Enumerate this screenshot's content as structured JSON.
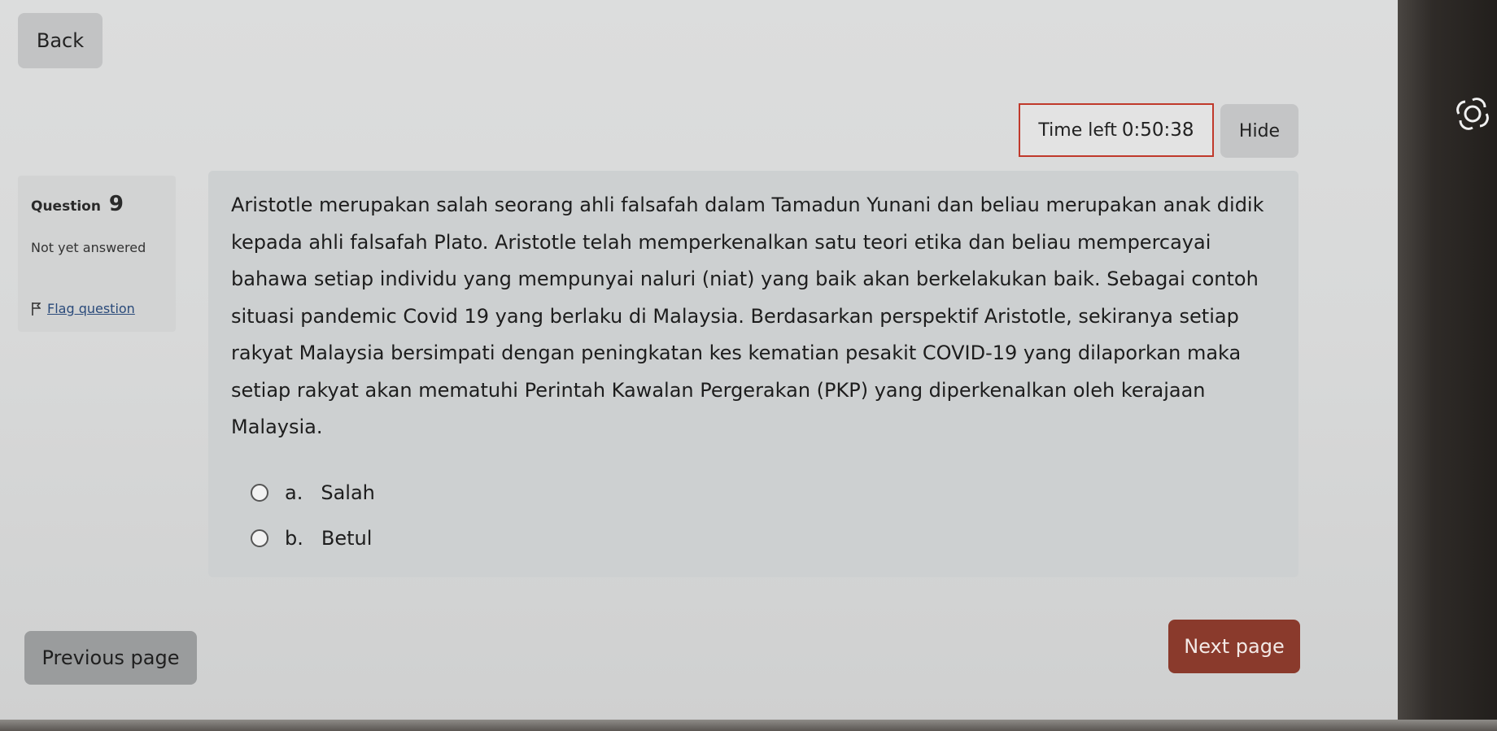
{
  "nav": {
    "back_label": "Back"
  },
  "timer": {
    "label": "Time left",
    "value": "0:50:38",
    "hide_label": "Hide"
  },
  "question_info": {
    "label": "Question",
    "number": "9",
    "status": "Not yet answered",
    "flag_label": "Flag question"
  },
  "question": {
    "text": "Aristotle merupakan salah seorang ahli falsafah dalam Tamadun Yunani dan beliau merupakan anak didik kepada ahli falsafah Plato. Aristotle telah memperkenalkan satu teori etika dan beliau mempercayai bahawa setiap individu yang mempunyai naluri (niat) yang baik akan berkelakukan baik. Sebagai contoh situasi pandemic Covid 19 yang berlaku di Malaysia. Berdasarkan perspektif Aristotle, sekiranya setiap rakyat Malaysia bersimpati dengan peningkatan kes kematian pesakit COVID-19 yang dilaporkan maka setiap rakyat akan mematuhi Perintah Kawalan Pergerakan (PKP) yang diperkenalkan oleh kerajaan Malaysia.",
    "options": [
      {
        "letter": "a.",
        "label": "Salah"
      },
      {
        "letter": "b.",
        "label": "Betul"
      }
    ]
  },
  "footer": {
    "previous_label": "Previous page",
    "next_label": "Next page"
  },
  "colors": {
    "timer_border": "#c0392b",
    "next_button": "#8a3a2c",
    "content_bg": "#cdd0d1"
  }
}
